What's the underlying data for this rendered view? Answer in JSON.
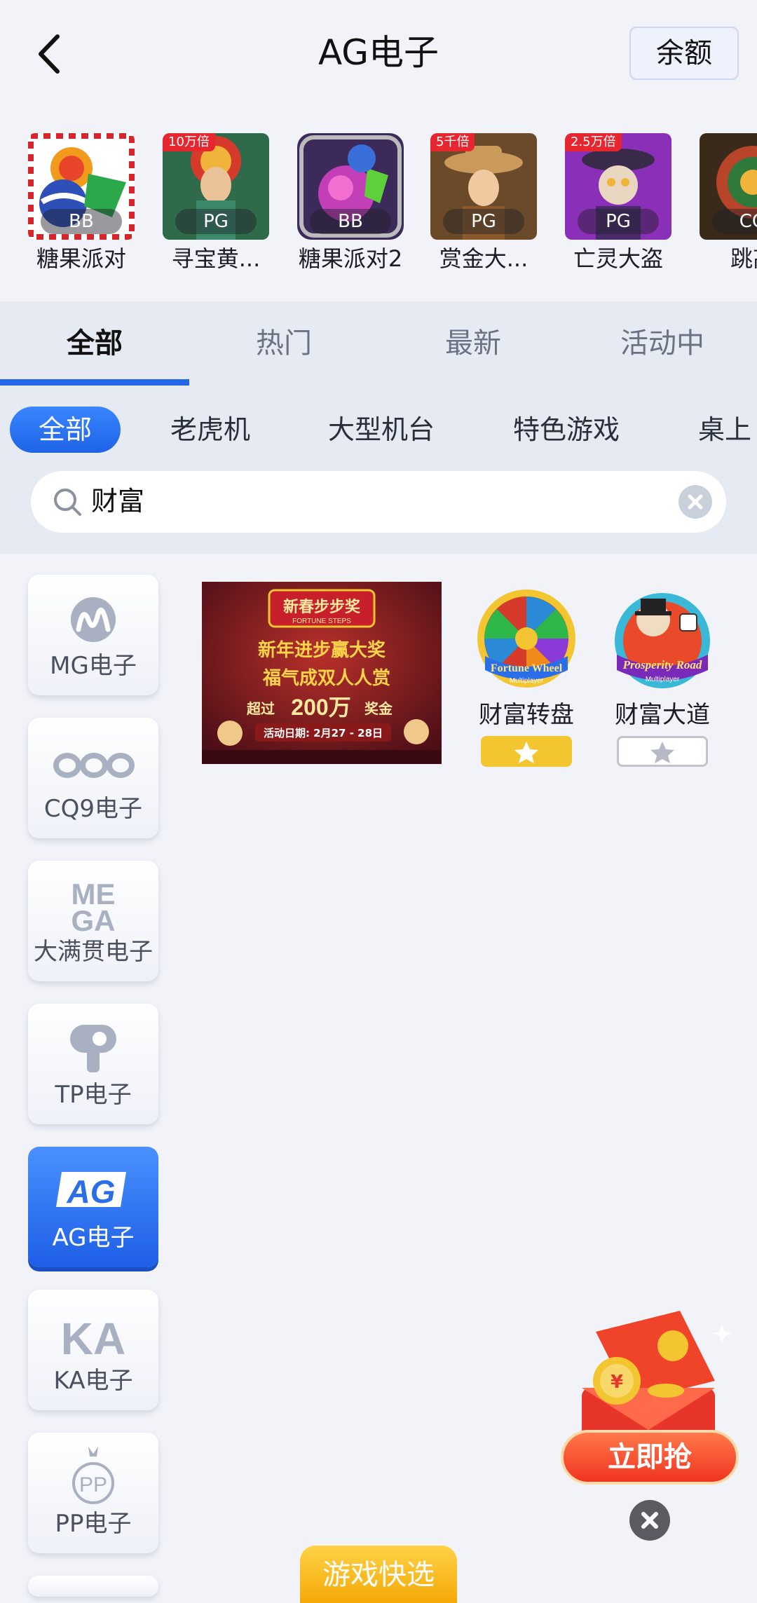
{
  "header": {
    "title": "AG电子",
    "balance_label": "余额"
  },
  "recent_games": [
    {
      "name": "糖果派对",
      "provider": "BB",
      "badge": ""
    },
    {
      "name": "寻宝黄...",
      "provider": "PG",
      "badge": "10万倍"
    },
    {
      "name": "糖果派对2",
      "provider": "BB",
      "badge": ""
    },
    {
      "name": "赏金大...",
      "provider": "PG",
      "badge": "5千倍"
    },
    {
      "name": "亡灵大盗",
      "provider": "PG",
      "badge": "2.5万倍"
    },
    {
      "name": "跳高",
      "provider": "CQ",
      "badge": ""
    }
  ],
  "tabs": [
    "全部",
    "热门",
    "最新",
    "活动中"
  ],
  "active_tab": "全部",
  "subtabs": [
    "全部",
    "老虎机",
    "大型机台",
    "特色游戏",
    "桌上"
  ],
  "search": {
    "value": "财富",
    "placeholder": ""
  },
  "providers": [
    {
      "label": "MG电子",
      "icon": "mg-logo-icon"
    },
    {
      "label": "CQ9电子",
      "icon": "cq9-logo-icon"
    },
    {
      "label": "大满贯电子",
      "icon": "mega-logo-icon",
      "logo_text": "MEGA"
    },
    {
      "label": "TP电子",
      "icon": "tp-logo-icon"
    },
    {
      "label": "AG电子",
      "icon": "ag-logo-icon",
      "logo_text": "AG",
      "active": true
    },
    {
      "label": "KA电子",
      "icon": "ka-logo-icon",
      "logo_text": "KA"
    },
    {
      "label": "PP电子",
      "icon": "pp-logo-icon",
      "logo_text": "PP"
    }
  ],
  "banner": {
    "heading": "新春步步奖",
    "sub_heading": "FORTUNE STEPS",
    "line1": "新年进步赢大奖",
    "line2": "福气成双人人赏",
    "prize_pre": "超过",
    "prize_amount": "200万",
    "prize_post": "奖金",
    "dates": "活动日期: 2月27 - 28日"
  },
  "results": [
    {
      "name": "财富转盘",
      "art_title": "Fortune Wheel",
      "art_sub": "Multiplayer",
      "favorited": true
    },
    {
      "name": "财富大道",
      "art_title": "Prosperity Road",
      "art_sub": "Multiplayer",
      "favorited": false
    }
  ],
  "promo": {
    "button_label": "立即抢"
  },
  "quick_pick_label": "游戏快选",
  "colors": {
    "accent": "#2466e8",
    "gold": "#f2c531",
    "promo_red": "#f0331f",
    "badge_red": "#e8262f"
  }
}
